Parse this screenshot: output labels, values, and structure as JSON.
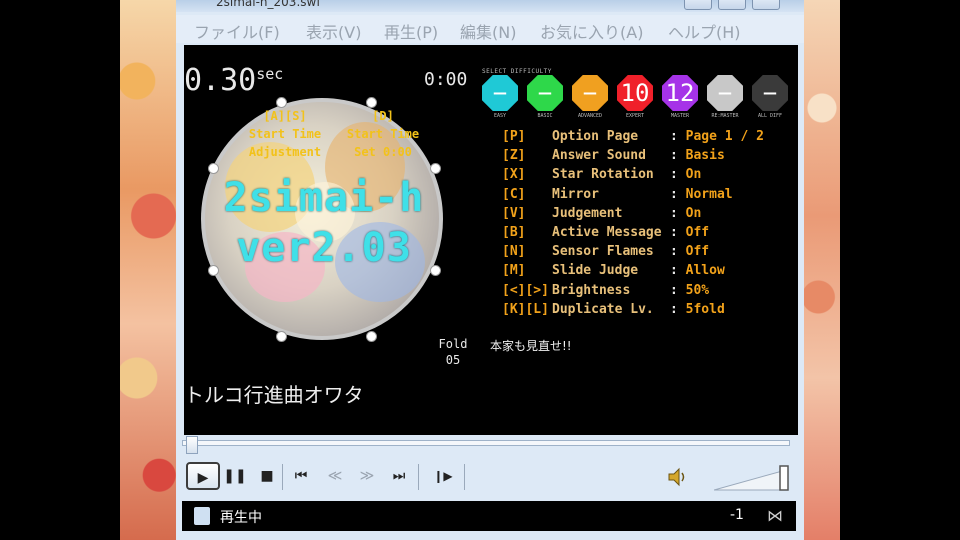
{
  "window": {
    "title": "2simai-h_203.swf"
  },
  "menu": [
    "ファイル(F)",
    "表示(V)",
    "再生(P)",
    "編集(N)",
    "お気に入り(A)",
    "ヘルプ(H)"
  ],
  "game": {
    "offset_value": "0.30",
    "offset_unit": "sec",
    "clock": "0:00",
    "hint_left": [
      "[A][S]",
      "Start Time",
      "Adjustment"
    ],
    "hint_right": [
      "[D]",
      "Start Time",
      "Set 0:00"
    ],
    "title_line1": "2simai-h",
    "title_line2": "ver2.03",
    "difficulty_header": "SELECT DIFFICULTY",
    "difficulties": [
      {
        "value": "−",
        "label": "EASY",
        "color": "#1fc9d6"
      },
      {
        "value": "−",
        "label": "BASIC",
        "color": "#2ed84a"
      },
      {
        "value": "−",
        "label": "ADVANCED",
        "color": "#f0a020"
      },
      {
        "value": "10",
        "label": "EXPERT",
        "color": "#f0202a"
      },
      {
        "value": "12",
        "label": "MASTER",
        "color": "#a633e8"
      },
      {
        "value": "−",
        "label": "RE:MASTER",
        "color": "#c8c8c8"
      },
      {
        "value": "−",
        "label": "ALL DIFF",
        "color": "#3a3a3a"
      }
    ],
    "options": [
      {
        "key": "[P]",
        "name": "Option Page",
        "value": "Page 1 / 2"
      },
      {
        "key": "[Z]",
        "name": "Answer Sound",
        "value": "Basis"
      },
      {
        "key": "[X]",
        "name": "Star Rotation",
        "value": "On"
      },
      {
        "key": "[C]",
        "name": "Mirror",
        "value": "Normal"
      },
      {
        "key": "[V]",
        "name": "Judgement",
        "value": "On"
      },
      {
        "key": "[B]",
        "name": "Active Message",
        "value": "Off"
      },
      {
        "key": "[N]",
        "name": "Sensor Flames",
        "value": "Off"
      },
      {
        "key": "[M]",
        "name": "Slide Judge",
        "value": "Allow"
      },
      {
        "key": "[<][>]",
        "name": "Brightness",
        "value": "50%"
      },
      {
        "key": "[K][L]",
        "name": "Duplicate Lv.",
        "value": "5fold"
      }
    ],
    "fold_label": "Fold",
    "fold_value": "05",
    "message": "本家も見直せ!!",
    "song_title": "トルコ行進曲オワタ"
  },
  "controls": {
    "play": "▶",
    "pause": "❚❚",
    "stop": "■",
    "prev": "⏮",
    "rewind": "≪",
    "forward": "≫",
    "next": "⏭",
    "step": "❙▶"
  },
  "status": {
    "text": "再生中",
    "value": "-1",
    "end_icon": "⋈"
  },
  "colors": {
    "accent": "#f2a21a",
    "title_cyan": "#3fe0e8",
    "window": "#dde9f6"
  }
}
